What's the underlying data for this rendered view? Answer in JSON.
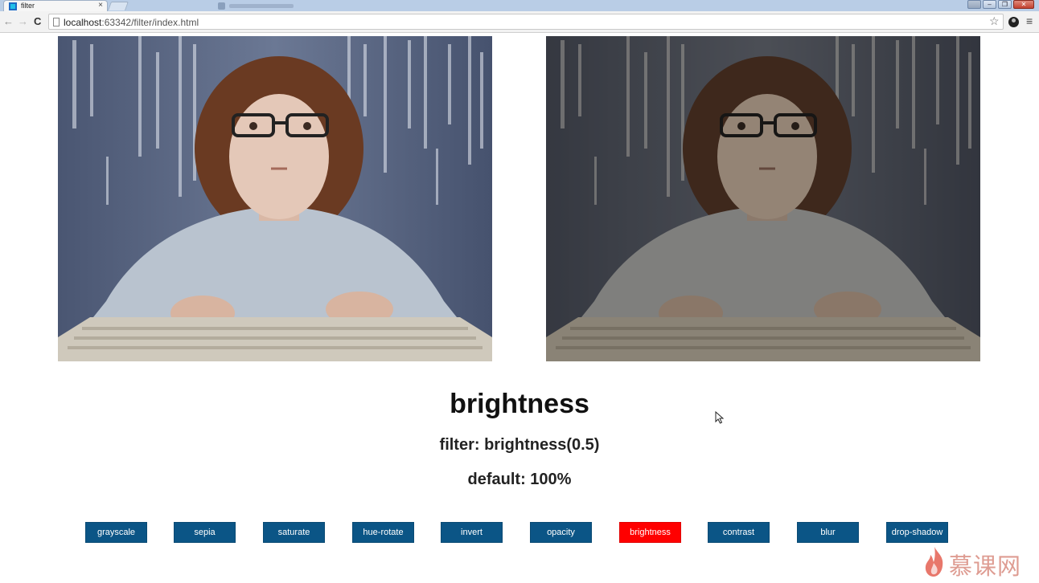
{
  "browser": {
    "tab_title": "filter",
    "tab_close": "×",
    "url_host": "localhost",
    "url_rest": ":63342/filter/index.html",
    "nav": {
      "back": "←",
      "forward": "→",
      "reload": "C"
    },
    "star_icon": "☆",
    "menu_icon": "≡",
    "window_buttons": {
      "minimize": "–",
      "restore": "❐",
      "close": "✕"
    }
  },
  "demo": {
    "filter_name": "brightness",
    "filter_expression": "filter: brightness(0.5)",
    "default_value": "default: 100%"
  },
  "filter_buttons": [
    {
      "label": "grayscale",
      "active": false
    },
    {
      "label": "sepia",
      "active": false
    },
    {
      "label": "saturate",
      "active": false
    },
    {
      "label": "hue-rotate",
      "active": false
    },
    {
      "label": "invert",
      "active": false
    },
    {
      "label": "opacity",
      "active": false
    },
    {
      "label": "brightness",
      "active": true
    },
    {
      "label": "contrast",
      "active": false
    },
    {
      "label": "blur",
      "active": false
    },
    {
      "label": "drop-shadow",
      "active": false
    }
  ],
  "colors": {
    "button_bg": "#0b5586",
    "button_active_bg": "#ff0000",
    "button_text": "#ffffff"
  },
  "watermark": {
    "text": "慕课网"
  }
}
